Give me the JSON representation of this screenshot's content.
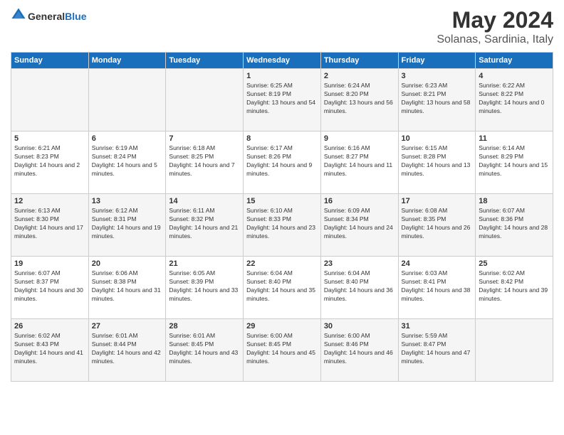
{
  "header": {
    "logo_general": "General",
    "logo_blue": "Blue",
    "title": "May 2024",
    "subtitle": "Solanas, Sardinia, Italy"
  },
  "days_of_week": [
    "Sunday",
    "Monday",
    "Tuesday",
    "Wednesday",
    "Thursday",
    "Friday",
    "Saturday"
  ],
  "weeks": [
    [
      {
        "day": "",
        "sunrise": "",
        "sunset": "",
        "daylight": ""
      },
      {
        "day": "",
        "sunrise": "",
        "sunset": "",
        "daylight": ""
      },
      {
        "day": "",
        "sunrise": "",
        "sunset": "",
        "daylight": ""
      },
      {
        "day": "1",
        "sunrise": "Sunrise: 6:25 AM",
        "sunset": "Sunset: 8:19 PM",
        "daylight": "Daylight: 13 hours and 54 minutes."
      },
      {
        "day": "2",
        "sunrise": "Sunrise: 6:24 AM",
        "sunset": "Sunset: 8:20 PM",
        "daylight": "Daylight: 13 hours and 56 minutes."
      },
      {
        "day": "3",
        "sunrise": "Sunrise: 6:23 AM",
        "sunset": "Sunset: 8:21 PM",
        "daylight": "Daylight: 13 hours and 58 minutes."
      },
      {
        "day": "4",
        "sunrise": "Sunrise: 6:22 AM",
        "sunset": "Sunset: 8:22 PM",
        "daylight": "Daylight: 14 hours and 0 minutes."
      }
    ],
    [
      {
        "day": "5",
        "sunrise": "Sunrise: 6:21 AM",
        "sunset": "Sunset: 8:23 PM",
        "daylight": "Daylight: 14 hours and 2 minutes."
      },
      {
        "day": "6",
        "sunrise": "Sunrise: 6:19 AM",
        "sunset": "Sunset: 8:24 PM",
        "daylight": "Daylight: 14 hours and 5 minutes."
      },
      {
        "day": "7",
        "sunrise": "Sunrise: 6:18 AM",
        "sunset": "Sunset: 8:25 PM",
        "daylight": "Daylight: 14 hours and 7 minutes."
      },
      {
        "day": "8",
        "sunrise": "Sunrise: 6:17 AM",
        "sunset": "Sunset: 8:26 PM",
        "daylight": "Daylight: 14 hours and 9 minutes."
      },
      {
        "day": "9",
        "sunrise": "Sunrise: 6:16 AM",
        "sunset": "Sunset: 8:27 PM",
        "daylight": "Daylight: 14 hours and 11 minutes."
      },
      {
        "day": "10",
        "sunrise": "Sunrise: 6:15 AM",
        "sunset": "Sunset: 8:28 PM",
        "daylight": "Daylight: 14 hours and 13 minutes."
      },
      {
        "day": "11",
        "sunrise": "Sunrise: 6:14 AM",
        "sunset": "Sunset: 8:29 PM",
        "daylight": "Daylight: 14 hours and 15 minutes."
      }
    ],
    [
      {
        "day": "12",
        "sunrise": "Sunrise: 6:13 AM",
        "sunset": "Sunset: 8:30 PM",
        "daylight": "Daylight: 14 hours and 17 minutes."
      },
      {
        "day": "13",
        "sunrise": "Sunrise: 6:12 AM",
        "sunset": "Sunset: 8:31 PM",
        "daylight": "Daylight: 14 hours and 19 minutes."
      },
      {
        "day": "14",
        "sunrise": "Sunrise: 6:11 AM",
        "sunset": "Sunset: 8:32 PM",
        "daylight": "Daylight: 14 hours and 21 minutes."
      },
      {
        "day": "15",
        "sunrise": "Sunrise: 6:10 AM",
        "sunset": "Sunset: 8:33 PM",
        "daylight": "Daylight: 14 hours and 23 minutes."
      },
      {
        "day": "16",
        "sunrise": "Sunrise: 6:09 AM",
        "sunset": "Sunset: 8:34 PM",
        "daylight": "Daylight: 14 hours and 24 minutes."
      },
      {
        "day": "17",
        "sunrise": "Sunrise: 6:08 AM",
        "sunset": "Sunset: 8:35 PM",
        "daylight": "Daylight: 14 hours and 26 minutes."
      },
      {
        "day": "18",
        "sunrise": "Sunrise: 6:07 AM",
        "sunset": "Sunset: 8:36 PM",
        "daylight": "Daylight: 14 hours and 28 minutes."
      }
    ],
    [
      {
        "day": "19",
        "sunrise": "Sunrise: 6:07 AM",
        "sunset": "Sunset: 8:37 PM",
        "daylight": "Daylight: 14 hours and 30 minutes."
      },
      {
        "day": "20",
        "sunrise": "Sunrise: 6:06 AM",
        "sunset": "Sunset: 8:38 PM",
        "daylight": "Daylight: 14 hours and 31 minutes."
      },
      {
        "day": "21",
        "sunrise": "Sunrise: 6:05 AM",
        "sunset": "Sunset: 8:39 PM",
        "daylight": "Daylight: 14 hours and 33 minutes."
      },
      {
        "day": "22",
        "sunrise": "Sunrise: 6:04 AM",
        "sunset": "Sunset: 8:40 PM",
        "daylight": "Daylight: 14 hours and 35 minutes."
      },
      {
        "day": "23",
        "sunrise": "Sunrise: 6:04 AM",
        "sunset": "Sunset: 8:40 PM",
        "daylight": "Daylight: 14 hours and 36 minutes."
      },
      {
        "day": "24",
        "sunrise": "Sunrise: 6:03 AM",
        "sunset": "Sunset: 8:41 PM",
        "daylight": "Daylight: 14 hours and 38 minutes."
      },
      {
        "day": "25",
        "sunrise": "Sunrise: 6:02 AM",
        "sunset": "Sunset: 8:42 PM",
        "daylight": "Daylight: 14 hours and 39 minutes."
      }
    ],
    [
      {
        "day": "26",
        "sunrise": "Sunrise: 6:02 AM",
        "sunset": "Sunset: 8:43 PM",
        "daylight": "Daylight: 14 hours and 41 minutes."
      },
      {
        "day": "27",
        "sunrise": "Sunrise: 6:01 AM",
        "sunset": "Sunset: 8:44 PM",
        "daylight": "Daylight: 14 hours and 42 minutes."
      },
      {
        "day": "28",
        "sunrise": "Sunrise: 6:01 AM",
        "sunset": "Sunset: 8:45 PM",
        "daylight": "Daylight: 14 hours and 43 minutes."
      },
      {
        "day": "29",
        "sunrise": "Sunrise: 6:00 AM",
        "sunset": "Sunset: 8:45 PM",
        "daylight": "Daylight: 14 hours and 45 minutes."
      },
      {
        "day": "30",
        "sunrise": "Sunrise: 6:00 AM",
        "sunset": "Sunset: 8:46 PM",
        "daylight": "Daylight: 14 hours and 46 minutes."
      },
      {
        "day": "31",
        "sunrise": "Sunrise: 5:59 AM",
        "sunset": "Sunset: 8:47 PM",
        "daylight": "Daylight: 14 hours and 47 minutes."
      },
      {
        "day": "",
        "sunrise": "",
        "sunset": "",
        "daylight": ""
      }
    ]
  ]
}
